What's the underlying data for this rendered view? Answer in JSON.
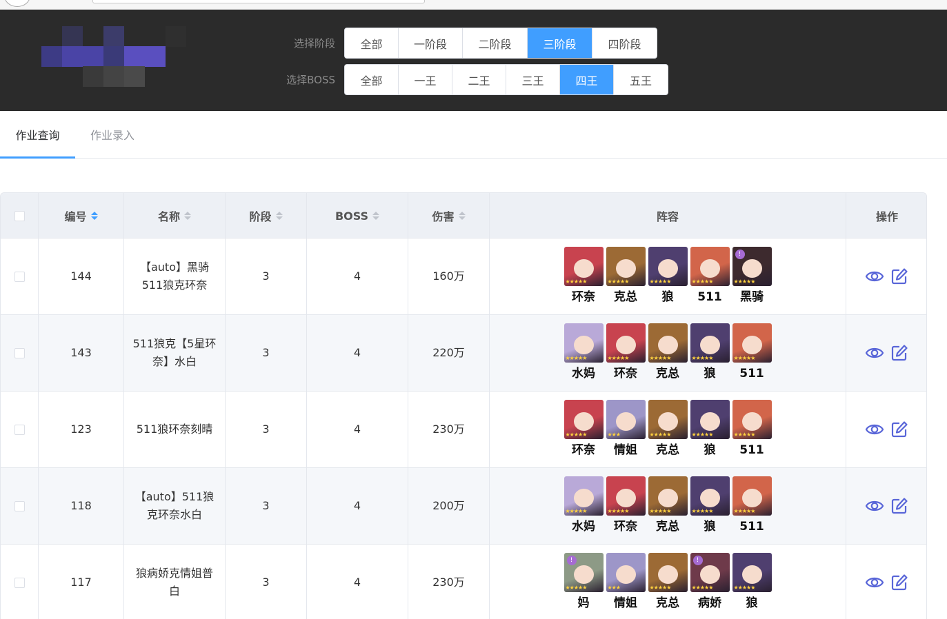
{
  "filters": {
    "stage": {
      "label": "选择阶段",
      "options": [
        "全部",
        "一阶段",
        "二阶段",
        "三阶段",
        "四阶段"
      ],
      "selected": "三阶段"
    },
    "boss": {
      "label": "选择BOSS",
      "options": [
        "全部",
        "一王",
        "二王",
        "三王",
        "四王",
        "五王"
      ],
      "selected": "四王"
    }
  },
  "tabs": [
    {
      "label": "作业查询",
      "active": true
    },
    {
      "label": "作业录入",
      "active": false
    }
  ],
  "table": {
    "headers": {
      "id": "编号",
      "name": "名称",
      "stage": "阶段",
      "boss": "BOSS",
      "damage": "伤害",
      "team": "阵容",
      "actions": "操作"
    },
    "sorted_column": "id",
    "rows": [
      {
        "id": "144",
        "name": "【auto】黑骑511狼克环奈",
        "stage": "3",
        "boss": "4",
        "damage": "160万",
        "team": [
          {
            "name": "环奈",
            "color": "#c8434f",
            "stars": 5
          },
          {
            "name": "克总",
            "color": "#9c6a35",
            "stars": 5
          },
          {
            "name": "狼",
            "color": "#4f3f6f",
            "stars": 5
          },
          {
            "name": "511",
            "color": "#d2654a",
            "stars": 5
          },
          {
            "name": "黑骑",
            "color": "#3d2a2e",
            "stars": 5,
            "rank": true
          }
        ]
      },
      {
        "id": "143",
        "name": "511狼克【5星环奈】水白",
        "stage": "3",
        "boss": "4",
        "damage": "220万",
        "team": [
          {
            "name": "水妈",
            "color": "#b9a9d8",
            "stars": 5
          },
          {
            "name": "环奈",
            "color": "#c8434f",
            "stars": 5
          },
          {
            "name": "克总",
            "color": "#9c6a35",
            "stars": 5
          },
          {
            "name": "狼",
            "color": "#4f3f6f",
            "stars": 5
          },
          {
            "name": "511",
            "color": "#d2654a",
            "stars": 5
          }
        ]
      },
      {
        "id": "123",
        "name": "511狼环奈刻晴",
        "stage": "3",
        "boss": "4",
        "damage": "230万",
        "team": [
          {
            "name": "环奈",
            "color": "#c8434f",
            "stars": 5
          },
          {
            "name": "情姐",
            "color": "#9d96c8",
            "stars": 3
          },
          {
            "name": "克总",
            "color": "#9c6a35",
            "stars": 5
          },
          {
            "name": "狼",
            "color": "#4f3f6f",
            "stars": 5
          },
          {
            "name": "511",
            "color": "#d2654a",
            "stars": 5
          }
        ]
      },
      {
        "id": "118",
        "name": "【auto】511狼克环奈水白",
        "stage": "3",
        "boss": "4",
        "damage": "200万",
        "team": [
          {
            "name": "水妈",
            "color": "#b9a9d8",
            "stars": 5
          },
          {
            "name": "环奈",
            "color": "#c8434f",
            "stars": 5
          },
          {
            "name": "克总",
            "color": "#9c6a35",
            "stars": 5
          },
          {
            "name": "狼",
            "color": "#4f3f6f",
            "stars": 5
          },
          {
            "name": "511",
            "color": "#d2654a",
            "stars": 5
          }
        ]
      },
      {
        "id": "117",
        "name": "狼病娇克情姐普白",
        "stage": "3",
        "boss": "4",
        "damage": "230万",
        "team": [
          {
            "name": "妈",
            "color": "#8d9a86",
            "stars": 5,
            "rank": true
          },
          {
            "name": "情姐",
            "color": "#9d96c8",
            "stars": 3
          },
          {
            "name": "克总",
            "color": "#9c6a35",
            "stars": 5
          },
          {
            "name": "病娇",
            "color": "#6e3a4a",
            "stars": 5,
            "rank": true
          },
          {
            "name": "狼",
            "color": "#4f3f6f",
            "stars": 5
          }
        ]
      }
    ]
  },
  "icons": {
    "view": "eye-icon",
    "edit": "edit-icon"
  },
  "colors": {
    "accent": "#409eff",
    "icon": "#5865d8",
    "header_bg": "#2b2b2b"
  }
}
